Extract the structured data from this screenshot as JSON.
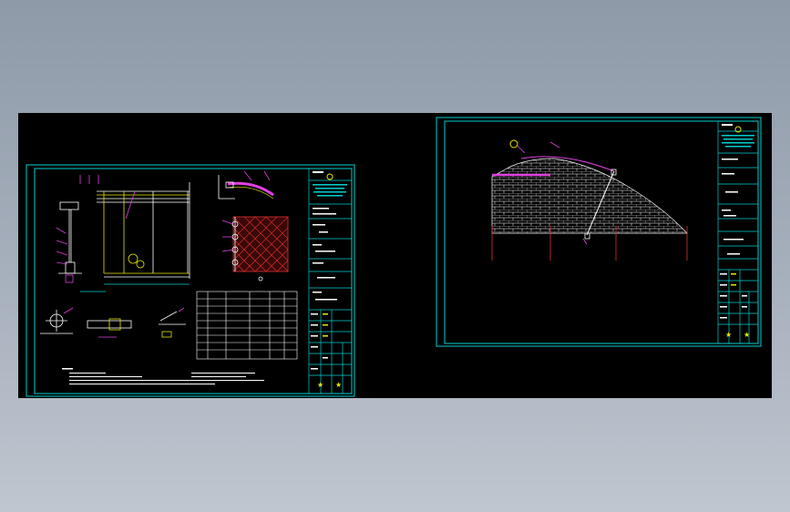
{
  "viewer": {
    "background": "#000000",
    "frame_color": "#00cfcf",
    "line_white": "#ffffff",
    "line_yellow": "#e8e800",
    "line_magenta": "#e040e0",
    "line_red": "#e03030"
  },
  "sheets": [
    {
      "name": "drawing-sheet-1",
      "title_block_rows": 12,
      "has_table": true,
      "has_notes": true
    },
    {
      "name": "drawing-sheet-2",
      "title_block_rows": 12,
      "has_table": false,
      "has_notes": false
    }
  ]
}
